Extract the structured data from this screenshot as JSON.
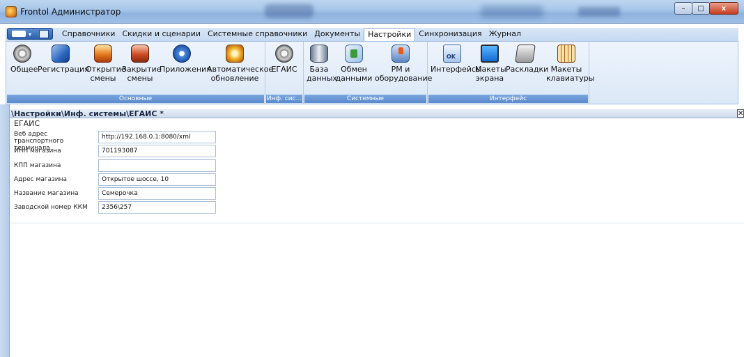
{
  "window": {
    "title": "Frontol Администратор",
    "minimize": "–",
    "maximize": "□",
    "close": "x"
  },
  "quick_toolbar": {
    "arrow": "▾"
  },
  "menu_tabs": [
    {
      "label": "Справочники"
    },
    {
      "label": "Скидки и сценарии"
    },
    {
      "label": "Системные справочники"
    },
    {
      "label": "Документы"
    },
    {
      "label": "Настройки",
      "active": true
    },
    {
      "label": "Синхронизация"
    },
    {
      "label": "Журнал"
    }
  ],
  "ribbon": {
    "groups": [
      {
        "label": "Основные",
        "buttons": [
          {
            "line1": "Общее",
            "line2": "",
            "icon": "gear-icon"
          },
          {
            "line1": "Регистрация",
            "line2": "",
            "icon": "registration-icon"
          },
          {
            "line1": "Открытие",
            "line2": "смены",
            "icon": "open-shift-icon"
          },
          {
            "line1": "Закрытие",
            "line2": "смены",
            "icon": "close-shift-icon"
          },
          {
            "line1": "Приложения",
            "line2": "",
            "icon": "applications-icon"
          },
          {
            "line1": "Автоматическое",
            "line2": "обновление",
            "icon": "auto-update-icon"
          }
        ]
      },
      {
        "label": "Инф. сис...",
        "buttons": [
          {
            "line1": "ЕГАИС",
            "line2": "",
            "icon": "egais-gear-icon"
          }
        ]
      },
      {
        "label": "Системные",
        "buttons": [
          {
            "line1": "База",
            "line2": "данных",
            "icon": "database-icon"
          },
          {
            "line1": "Обмен",
            "line2": "данными",
            "icon": "data-exchange-icon"
          },
          {
            "line1": "РМ и",
            "line2": "оборудование",
            "icon": "workstation-equipment-icon"
          }
        ]
      },
      {
        "label": "Интерфейс",
        "buttons": [
          {
            "line1": "Интерфейсы",
            "line2": "",
            "icon": "interfaces-icon"
          },
          {
            "line1": "Макеты",
            "line2": "экрана",
            "icon": "screen-layouts-icon"
          },
          {
            "line1": "Раскладки",
            "line2": "",
            "icon": "layouts-icon"
          },
          {
            "line1": "Макеты",
            "line2": "клавиатуры",
            "icon": "keyboard-layouts-icon"
          }
        ]
      }
    ]
  },
  "document": {
    "path": "\\Настройки\\Инф. системы\\ЕГАИС *",
    "close": "✕",
    "section_title": "ЕГАИС",
    "fields": [
      {
        "label": "Веб адрес транспортного терминала",
        "value": "http://192.168.0.1:8080/xml"
      },
      {
        "label": "ИНН магазина",
        "value": "701193087"
      },
      {
        "label": "КПП магазина",
        "value": ""
      },
      {
        "label": "Адрес магазина",
        "value": "Открытое шоссе, 10"
      },
      {
        "label": "Название магазина",
        "value": "Семерочка"
      },
      {
        "label": "Заводской номер ККМ",
        "value": "2356\\257"
      }
    ]
  }
}
